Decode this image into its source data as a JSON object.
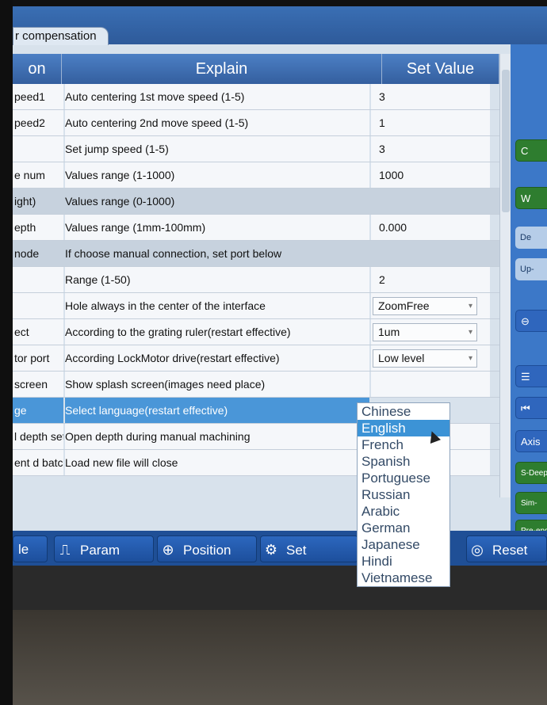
{
  "tab": {
    "label": "r compensation"
  },
  "headers": {
    "param": "on",
    "explain": "Explain",
    "set_value": "Set Value"
  },
  "rows": [
    {
      "param": "peed1",
      "explain": "Auto centering 1st move speed (1-5)",
      "value": "3"
    },
    {
      "param": "peed2",
      "explain": "Auto centering 2nd move speed (1-5)",
      "value": "1"
    },
    {
      "param": "",
      "explain": "Set jump speed (1-5)",
      "value": "3"
    },
    {
      "param": "e num",
      "explain": "Values range (1-1000)",
      "value": "1000"
    },
    {
      "param": "ight)",
      "explain": "Values range (0-1000)",
      "value": ""
    },
    {
      "param": "epth",
      "explain": "Values range (1mm-100mm)",
      "value": "0.000"
    },
    {
      "param": "node",
      "explain": "If choose manual connection, set port below",
      "value": ""
    },
    {
      "param": "",
      "explain": "Range (1-50)",
      "value": "2"
    },
    {
      "param": "",
      "explain": "Hole always in the center of the interface",
      "value": "ZoomFree"
    },
    {
      "param": "ect",
      "explain": "According to the grating ruler(restart effective)",
      "value": "1um"
    },
    {
      "param": "tor port",
      "explain": "According LockMotor drive(restart effective)",
      "value": "Low level"
    },
    {
      "param": "screen",
      "explain": "Show splash screen(images need place)",
      "value": ""
    },
    {
      "param": "ge",
      "explain": "Select language(restart effective)",
      "value": ""
    },
    {
      "param": "l depth set",
      "explain": "Open depth during manual machining",
      "value": ""
    },
    {
      "param": "ent d batch",
      "explain": "Load new file will close",
      "value": ""
    }
  ],
  "language_options": [
    "Chinese",
    "English",
    "French",
    "Spanish",
    "Portuguese",
    "Russian",
    "Arabic",
    "German",
    "Japanese",
    "Hindi",
    "Vietnamese"
  ],
  "language_selected": "English",
  "bottom": {
    "left_label": "le",
    "param": "Param",
    "position": "Position",
    "set": "Set",
    "reset": "Reset"
  },
  "right": {
    "c": "C",
    "w": "W",
    "de": "De",
    "up": "Up-",
    "axis": "Axis",
    "sdeep": "S-Deep",
    "simrun": "Sim-Run",
    "preend": "Pre-end"
  }
}
